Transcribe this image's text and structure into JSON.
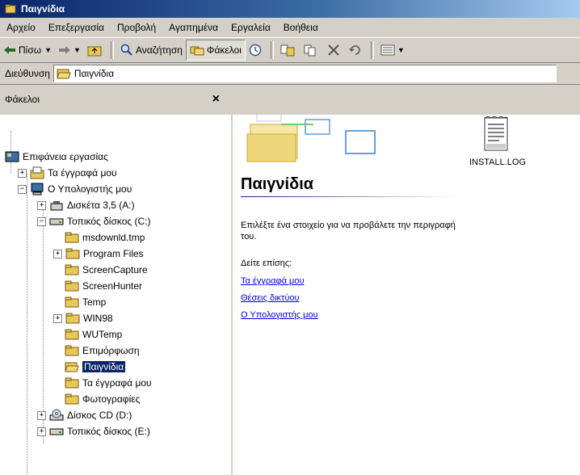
{
  "window": {
    "title": "Παιγνίδια"
  },
  "menu": [
    "Αρχείο",
    "Επεξεργασία",
    "Προβολή",
    "Αγαπημένα",
    "Εργαλεία",
    "Βοήθεια"
  ],
  "toolbar": {
    "back": "Πίσω",
    "search": "Αναζήτηση",
    "folders": "Φάκελοι"
  },
  "address": {
    "label": "Διεύθυνση",
    "value": "Παιγνίδια"
  },
  "folders_pane": {
    "title": "Φάκελοι",
    "close": "×",
    "tree": [
      {
        "label": "Επιφάνεια εργασίας",
        "icon": "desktop-icon"
      },
      {
        "label": "Τα έγγραφά μου",
        "icon": "documents-folder-icon",
        "pm": "+"
      },
      {
        "label": "Ο Υπολογιστής μου",
        "icon": "computer-icon",
        "pm": "−"
      },
      {
        "label": "Δισκέτα 3,5 (A:)",
        "icon": "floppy-icon",
        "pm": "+"
      },
      {
        "label": "Τοπικός δίσκος (C:)",
        "icon": "drive-icon",
        "pm": "−"
      },
      {
        "label": "msdownld.tmp",
        "icon": "folder-icon"
      },
      {
        "label": "Program Files",
        "icon": "folder-icon",
        "pm": "+"
      },
      {
        "label": "ScreenCapture",
        "icon": "folder-icon"
      },
      {
        "label": "ScreenHunter",
        "icon": "folder-icon"
      },
      {
        "label": "Temp",
        "icon": "folder-icon"
      },
      {
        "label": "WIN98",
        "icon": "folder-icon",
        "pm": "+"
      },
      {
        "label": "WUTemp",
        "icon": "folder-icon"
      },
      {
        "label": "Επιμόρφωση",
        "icon": "folder-icon"
      },
      {
        "label": "Παιγνίδια",
        "icon": "open-folder-icon",
        "selected": true
      },
      {
        "label": "Τα έγγραφά μου",
        "icon": "folder-icon"
      },
      {
        "label": "Φωτογραφίες",
        "icon": "folder-icon"
      },
      {
        "label": "Δίσκος CD (D:)",
        "icon": "cd-drive-icon",
        "pm": "+"
      },
      {
        "label": "Τοπικός δίσκος (E:)",
        "icon": "drive-icon",
        "pm": "+"
      }
    ]
  },
  "content": {
    "folder_title": "Παιγνίδια",
    "description": "Επιλέξτε ένα στοιχείο για να προβάλετε την περιγραφή του.",
    "see_also": "Δείτε επίσης:",
    "links": [
      "Τα έγγραφά μου",
      "Θέσεις δικτύου",
      "Ο Υπολογιστής μου"
    ],
    "file": {
      "name": "INSTALL.LOG",
      "icon": "text-file-icon"
    }
  }
}
